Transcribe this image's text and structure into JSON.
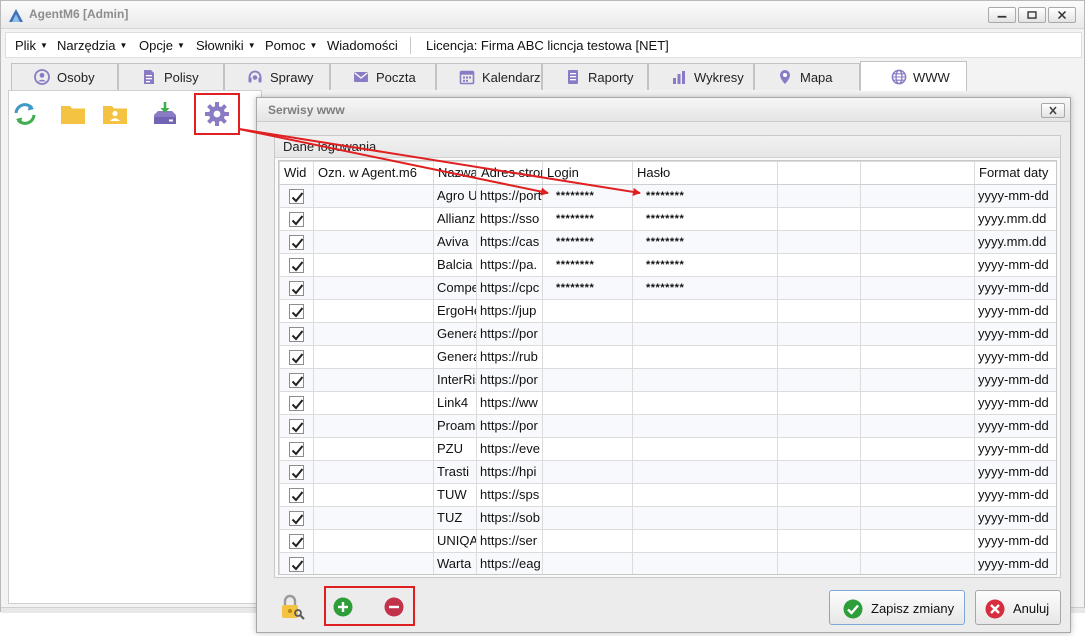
{
  "window": {
    "title": "AgentM6 [Admin]"
  },
  "menu": {
    "items": [
      {
        "label": "Plik",
        "has_dropdown": true
      },
      {
        "label": "Narzędzia",
        "has_dropdown": true
      },
      {
        "label": "Opcje",
        "has_dropdown": true
      },
      {
        "label": "Słowniki",
        "has_dropdown": true
      },
      {
        "label": "Pomoc",
        "has_dropdown": true
      },
      {
        "label": "Wiadomości",
        "has_dropdown": false
      }
    ],
    "license": "Licencja: Firma ABC licncja testowa [NET]"
  },
  "tabs": [
    {
      "label": "Osoby",
      "icon": "person-icon"
    },
    {
      "label": "Polisy",
      "icon": "document-icon"
    },
    {
      "label": "Sprawy",
      "icon": "headset-icon"
    },
    {
      "label": "Poczta",
      "icon": "mail-icon"
    },
    {
      "label": "Kalendarz",
      "icon": "calendar-icon"
    },
    {
      "label": "Raporty",
      "icon": "report-icon"
    },
    {
      "label": "Wykresy",
      "icon": "bar-chart-icon"
    },
    {
      "label": "Mapa",
      "icon": "map-pin-icon"
    },
    {
      "label": "WWW",
      "icon": "globe-icon",
      "active": true
    }
  ],
  "toolbar": {
    "icons": [
      "refresh-icon",
      "folder-icon",
      "user-folder-icon",
      "download-tray-icon",
      "gear-icon"
    ]
  },
  "dialog": {
    "title": "Serwisy www",
    "group_caption": "Dane logowania",
    "columns": [
      "Wid",
      "Ozn. w Agent.m6",
      "Nazwa",
      "Adres strony",
      "Login",
      "Hasło",
      "",
      "",
      "Format daty"
    ],
    "rows": [
      {
        "checked": true,
        "ozn": "",
        "nazwa": "Agro Ubezpieczenia",
        "adres": "https://portal",
        "login": "********",
        "haslo": "********",
        "format": "yyyy-mm-dd"
      },
      {
        "checked": true,
        "ozn": "",
        "nazwa": "Allianz",
        "adres": "https://sso",
        "login": "********",
        "haslo": "********",
        "format": "yyyy.mm.dd"
      },
      {
        "checked": true,
        "ozn": "",
        "nazwa": "Aviva",
        "adres": "https://cas",
        "login": "********",
        "haslo": "********",
        "format": "yyyy.mm.dd"
      },
      {
        "checked": true,
        "ozn": "",
        "nazwa": "Balcia",
        "adres": "https://pa.",
        "login": "********",
        "haslo": "********",
        "format": "yyyy-mm-dd"
      },
      {
        "checked": true,
        "ozn": "",
        "nazwa": "Compensa",
        "adres": "https://cpc",
        "login": "********",
        "haslo": "********",
        "format": "yyyy-mm-dd"
      },
      {
        "checked": true,
        "ozn": "",
        "nazwa": "ErgoHestia",
        "adres": "https://jup",
        "login": "",
        "haslo": "",
        "format": "yyyy-mm-dd"
      },
      {
        "checked": true,
        "ozn": "",
        "nazwa": "Generali",
        "adres": "https://por",
        "login": "",
        "haslo": "",
        "format": "yyyy-mm-dd"
      },
      {
        "checked": true,
        "ozn": "",
        "nazwa": "Generali",
        "adres": "https://rub",
        "login": "",
        "haslo": "",
        "format": "yyyy-mm-dd"
      },
      {
        "checked": true,
        "ozn": "",
        "nazwa": "InterRisk",
        "adres": "https://por",
        "login": "",
        "haslo": "",
        "format": "yyyy-mm-dd"
      },
      {
        "checked": true,
        "ozn": "",
        "nazwa": "Link4",
        "adres": "https://ww",
        "login": "",
        "haslo": "",
        "format": "yyyy-mm-dd"
      },
      {
        "checked": true,
        "ozn": "",
        "nazwa": "Proama",
        "adres": "https://por",
        "login": "",
        "haslo": "",
        "format": "yyyy-mm-dd"
      },
      {
        "checked": true,
        "ozn": "",
        "nazwa": "PZU",
        "adres": "https://eve",
        "login": "",
        "haslo": "",
        "format": "yyyy-mm-dd"
      },
      {
        "checked": true,
        "ozn": "",
        "nazwa": "Trasti",
        "adres": "https://hpi",
        "login": "",
        "haslo": "",
        "format": "yyyy-mm-dd"
      },
      {
        "checked": true,
        "ozn": "",
        "nazwa": "TUW",
        "adres": "https://sps",
        "login": "",
        "haslo": "",
        "format": "yyyy-mm-dd"
      },
      {
        "checked": true,
        "ozn": "",
        "nazwa": "TUZ",
        "adres": "https://sob",
        "login": "",
        "haslo": "",
        "format": "yyyy-mm-dd"
      },
      {
        "checked": true,
        "ozn": "",
        "nazwa": "UNIQA",
        "adres": "https://ser",
        "login": "",
        "haslo": "",
        "format": "yyyy-mm-dd"
      },
      {
        "checked": true,
        "ozn": "",
        "nazwa": "Warta",
        "adres": "https://eag",
        "login": "",
        "haslo": "",
        "format": "yyyy-mm-dd"
      }
    ],
    "buttons": {
      "save": "Zapisz zmiany",
      "cancel": "Anuluj"
    }
  },
  "colors": {
    "accent_blue": "#3f7fc0",
    "toolbar_yellow": "#f5c342",
    "toolbar_purple": "#8a7bc4",
    "add_green": "#2e9e3a",
    "remove_red": "#c2334b",
    "highlight_red": "#e02020"
  }
}
